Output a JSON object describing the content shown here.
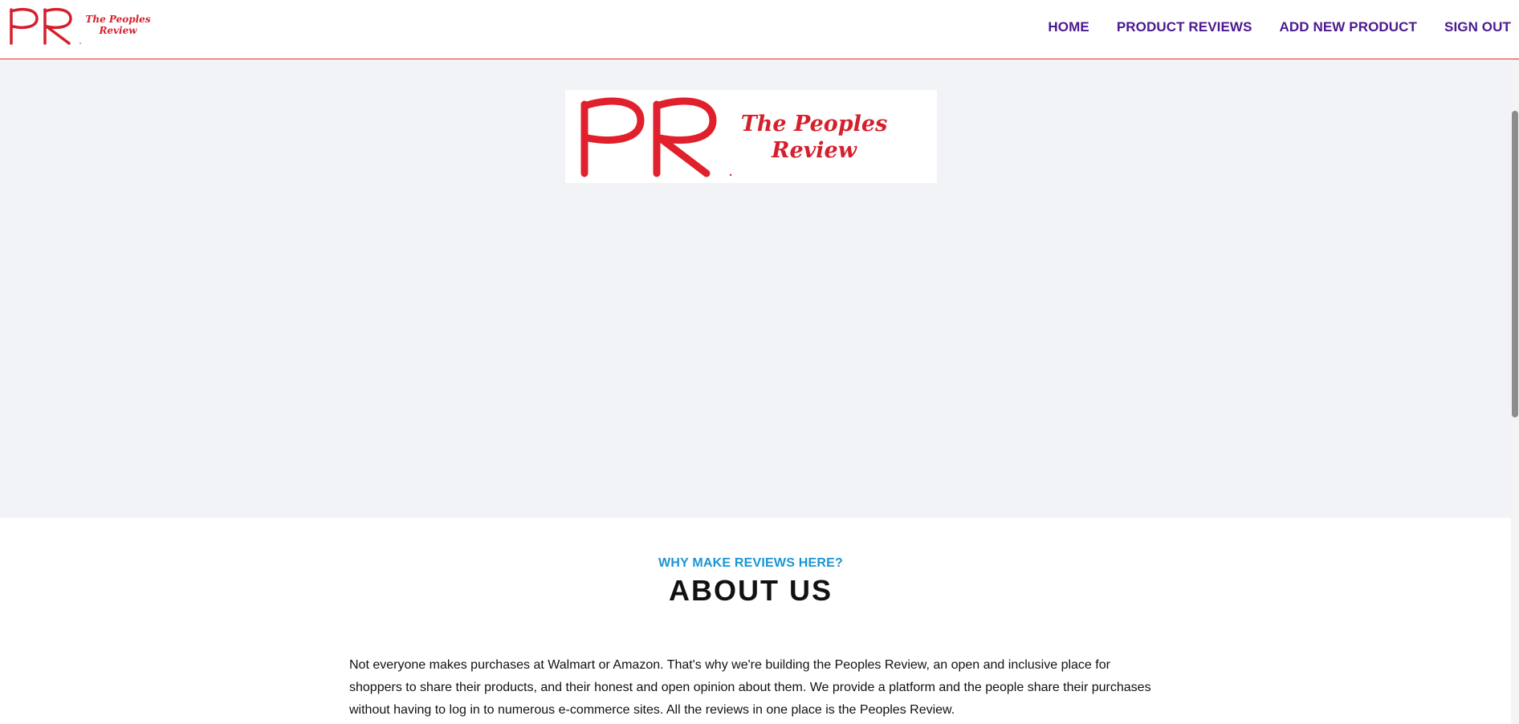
{
  "brand": {
    "mark": "PR",
    "name_line1": "The Peoples",
    "name_line2": "Review",
    "color": "#d61f2c"
  },
  "nav": {
    "items": [
      {
        "label": "HOME"
      },
      {
        "label": "PRODUCT REVIEWS"
      },
      {
        "label": "ADD NEW PRODUCT"
      },
      {
        "label": "SIGN OUT"
      }
    ],
    "color": "#4b1a8f"
  },
  "about": {
    "kicker": "WHY MAKE REVIEWS HERE?",
    "title": "ABOUT US",
    "body": "Not everyone makes purchases at Walmart or Amazon. That's why we're building the Peoples Review, an open and inclusive place for shoppers to share their products, and their honest and open opinion about them. We provide a platform and the people share their purchases without having to log in to numerous e-commerce sites. All the reviews in one place is the Peoples Review.",
    "kicker_color": "#1a96d4"
  },
  "colors": {
    "hero_background": "#f2f3f7",
    "header_border": "#e02424"
  }
}
